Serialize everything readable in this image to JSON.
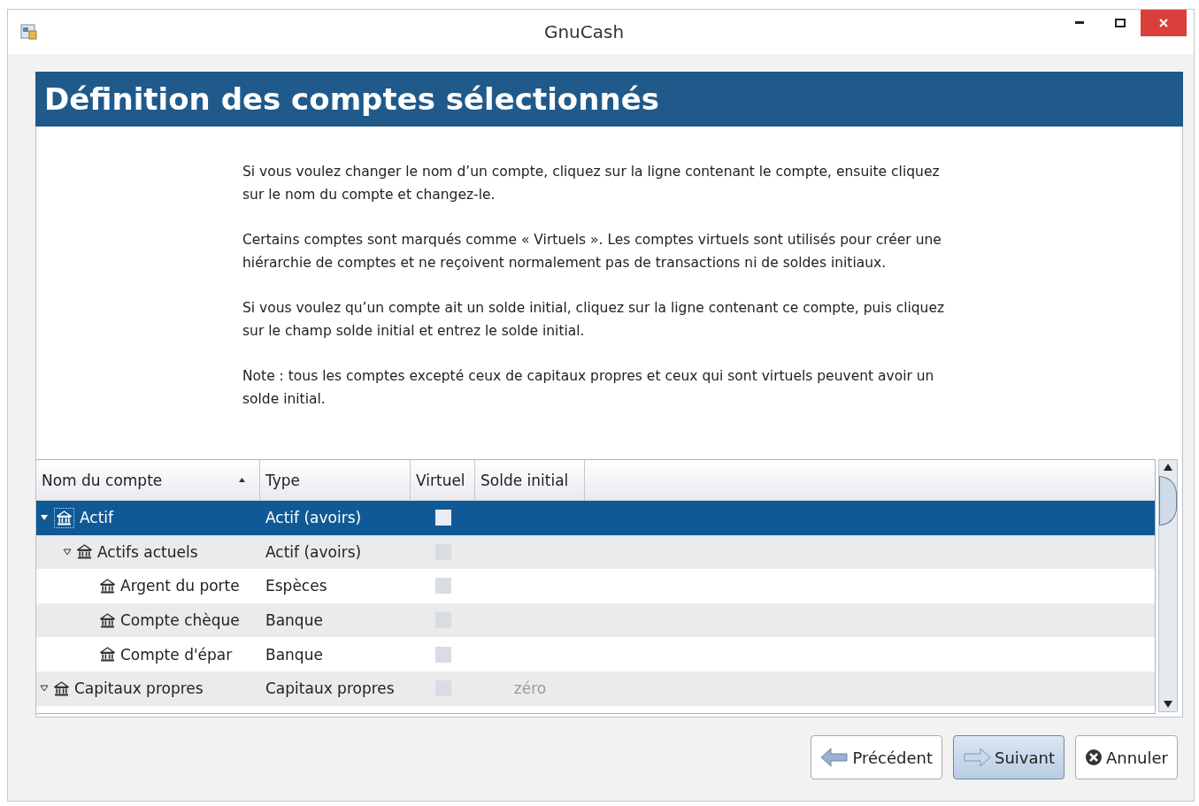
{
  "window": {
    "title": "GnuCash"
  },
  "page": {
    "title": "Définition des comptes sélectionnés",
    "paragraphs": [
      "Si vous voulez changer le nom d’un compte, cliquez sur la ligne contenant le compte, ensuite cliquez sur le nom du compte et changez-le.",
      "Certains comptes sont marqués comme « Virtuels ». Les comptes virtuels sont utilisés pour créer une hiérarchie de comptes et ne reçoivent normalement pas de transactions ni de soldes initiaux.",
      "Si vous voulez qu’un compte ait un solde initial, cliquez sur la ligne contenant ce compte, puis cliquez sur le champ solde initial et entrez le solde initial.",
      "Note : tous les comptes excepté ceux de capitaux propres et ceux qui sont virtuels peuvent avoir un solde initial."
    ]
  },
  "table": {
    "columns": [
      {
        "label": "Nom du compte",
        "sorted": true
      },
      {
        "label": "Type",
        "sorted": false
      },
      {
        "label": "Virtuel",
        "sorted": false
      },
      {
        "label": "Solde initial",
        "sorted": false
      }
    ],
    "rows": [
      {
        "name": "Actif",
        "type": "Actif (avoirs)",
        "virtual": false,
        "selected": true,
        "expanded": true,
        "children": [
          {
            "name": "Actifs actuels",
            "type": "Actif (avoirs)",
            "virtual": false,
            "selected": false,
            "expanded": true,
            "children": [
              {
                "name": "Argent du porte",
                "type": "Espèces",
                "virtual": false,
                "selected": false
              },
              {
                "name": "Compte chèque",
                "type": "Banque",
                "virtual": false,
                "selected": false
              },
              {
                "name": "Compte d'épar",
                "type": "Banque",
                "virtual": false,
                "selected": false
              }
            ]
          }
        ]
      },
      {
        "name": "Capitaux propres",
        "type": "Capitaux propres",
        "virtual": false,
        "selected": false,
        "expanded": true,
        "balance": "zéro"
      }
    ]
  },
  "buttons": [
    {
      "kind": "back",
      "label": "Précédent",
      "default": false
    },
    {
      "kind": "next",
      "label": "Suivant",
      "default": true
    },
    {
      "kind": "cancel",
      "label": "Annuler",
      "default": false
    }
  ]
}
